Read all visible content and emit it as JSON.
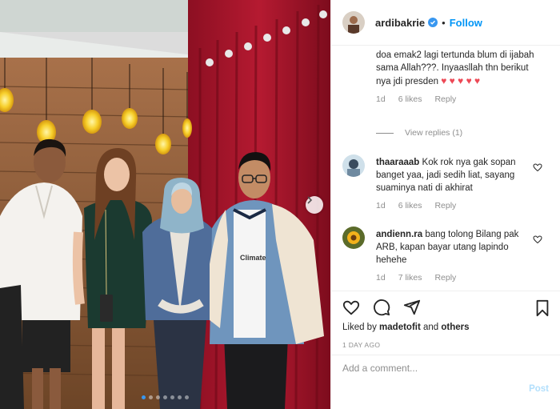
{
  "header": {
    "username": "ardibakrie",
    "separator": "•",
    "follow_label": "Follow"
  },
  "comments": [
    {
      "text": "doa emak2 lagi tertunda blum di ijabah sama Allah???. Inyaasllah thn berikut nya jdi presden",
      "time": "1d",
      "likes": "6 likes",
      "reply": "Reply"
    },
    {
      "username": "thaaraaab",
      "text": "Kok rok nya gak sopan banget yaa, jadi sedih liat, sayang suaminya nati di akhirat",
      "time": "1d",
      "likes": "6 likes",
      "reply": "Reply"
    },
    {
      "username": "andienn.ra",
      "text": "bang tolong Bilang pak ARB, kapan bayar utang lapindo hehehe",
      "time": "1d",
      "likes": "7 likes",
      "reply": "Reply"
    }
  ],
  "view_replies": "View replies (1)",
  "likes_row": {
    "prefix": "Liked by",
    "user": "madetofit",
    "and": "and",
    "others": "others"
  },
  "timestamp": "1 DAY AGO",
  "add_comment": {
    "placeholder": "Add a comment...",
    "post_label": "Post"
  },
  "carousel": {
    "total_slides": 7,
    "active_index": 0
  },
  "photo_overlay": {
    "shirt_text": "Climate"
  },
  "colors": {
    "link_blue": "#0095f6",
    "verified_blue": "#3897f0",
    "heart_red": "#ed4956",
    "muted_gray": "#8e8e8e",
    "curtain_red": "#a8162c"
  }
}
